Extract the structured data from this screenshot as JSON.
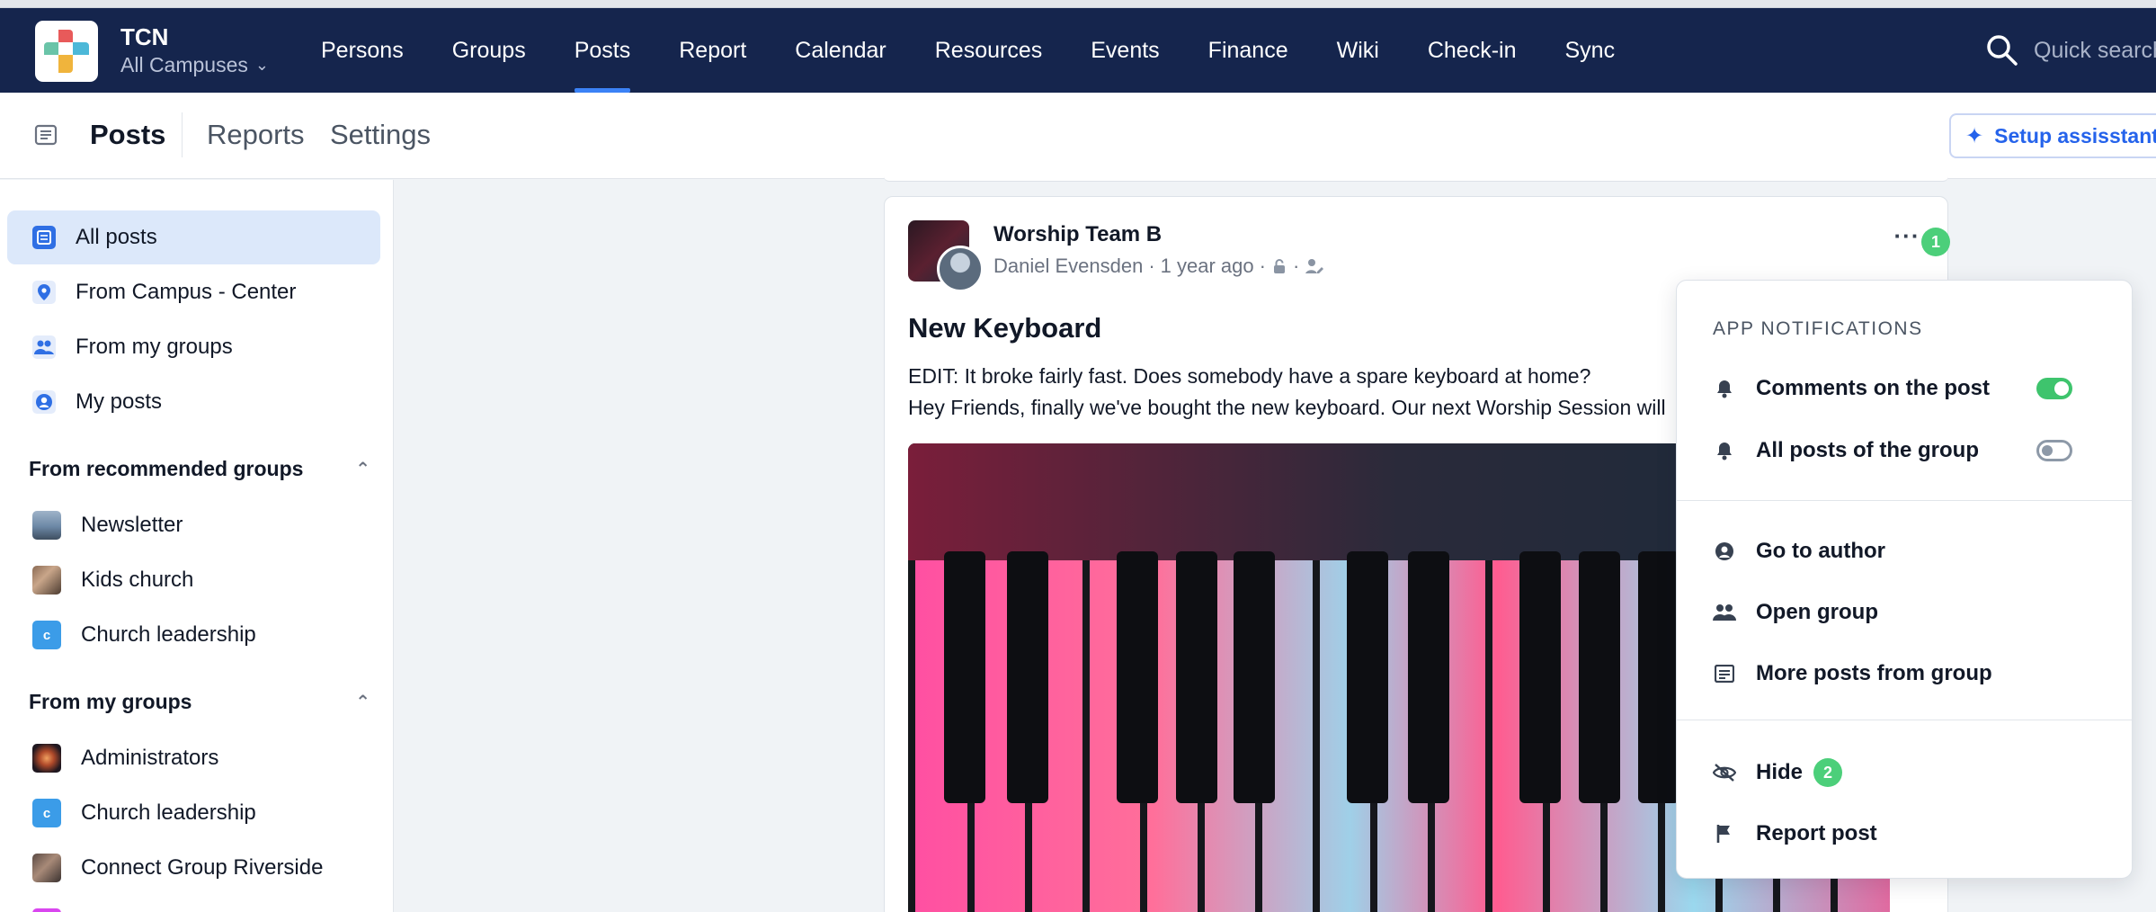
{
  "topnav": {
    "org_name": "TCN",
    "campus": "All Campuses",
    "items": [
      "Persons",
      "Groups",
      "Posts",
      "Report",
      "Calendar",
      "Resources",
      "Events",
      "Finance",
      "Wiki",
      "Check-in",
      "Sync"
    ],
    "active": "Posts",
    "search_placeholder": "Quick search"
  },
  "subheader": {
    "title": "Posts",
    "links": [
      "Reports",
      "Settings"
    ],
    "setup_button": "Setup assisstant"
  },
  "sidebar": {
    "main_items": [
      {
        "label": "All posts",
        "icon": "posts-icon",
        "active": true
      },
      {
        "label": "From Campus - Center",
        "icon": "location-pin-icon"
      },
      {
        "label": "From my groups",
        "icon": "people-icon"
      },
      {
        "label": "My posts",
        "icon": "user-circle-icon"
      }
    ],
    "recommended_heading": "From recommended groups",
    "recommended_items": [
      {
        "label": "Newsletter",
        "thumb": "photo"
      },
      {
        "label": "Kids church",
        "thumb": "photo"
      },
      {
        "label": "Church leadership",
        "thumb": "letter",
        "letter": "c"
      }
    ],
    "my_groups_heading": "From my groups",
    "my_groups_items": [
      {
        "label": "Administrators",
        "thumb": "photo"
      },
      {
        "label": "Church leadership",
        "thumb": "letter",
        "letter": "c"
      },
      {
        "label": "Connect Group Riverside",
        "thumb": "photo"
      }
    ]
  },
  "post": {
    "group_name": "Worship Team B",
    "author": "Daniel Evensden",
    "time": "1 year ago",
    "title": "New Keyboard",
    "body_line1": "EDIT: It broke fairly fast. Does somebody have a spare keyboard at home?",
    "body_line2": "Hey Friends, finally we've bought the new keyboard. Our next Worship Session will",
    "badge_more": "1"
  },
  "menu": {
    "heading": "APP NOTIFICATIONS",
    "toggles": [
      {
        "label": "Comments on the post",
        "on": true
      },
      {
        "label": "All posts of the group",
        "on": false
      }
    ],
    "nav_items": [
      "Go to author",
      "Open group",
      "More posts from group"
    ],
    "action_items": [
      {
        "label": "Hide",
        "badge": "2"
      },
      {
        "label": "Report post"
      }
    ]
  },
  "colors": {
    "topbar": "#15254d",
    "accent": "#3b82f6",
    "badge": "#4ccf7a",
    "toggle_on": "#3ec46d"
  }
}
